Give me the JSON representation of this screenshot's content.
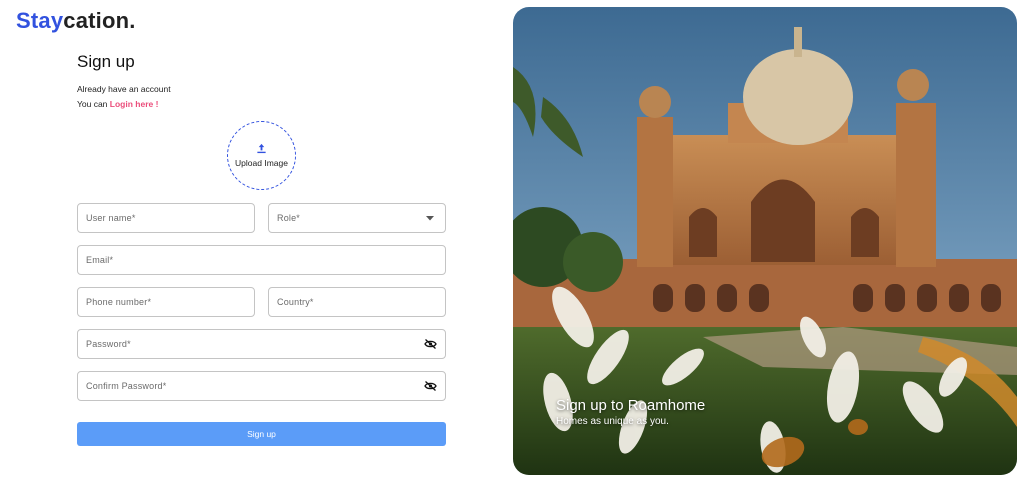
{
  "logo": {
    "part1": "Stay",
    "part2": "cation."
  },
  "form": {
    "title": "Sign up",
    "already": "Already have an account",
    "you_can": "You can ",
    "login_link": "Login here !",
    "upload_label": "Upload Image",
    "fields": {
      "username": "User name*",
      "role": "Role*",
      "email": "Email*",
      "phone": "Phone number*",
      "country": "Country*",
      "password": "Password*",
      "confirm_password": "Confirm Password*"
    },
    "submit_label": "Sign up"
  },
  "hero": {
    "heading": "Sign up to Roamhome",
    "subheading": "Homes as unique as you."
  },
  "colors": {
    "brand_blue": "#3252df",
    "link_pink": "#eb4d7b",
    "button_blue": "#5b9cf8"
  }
}
